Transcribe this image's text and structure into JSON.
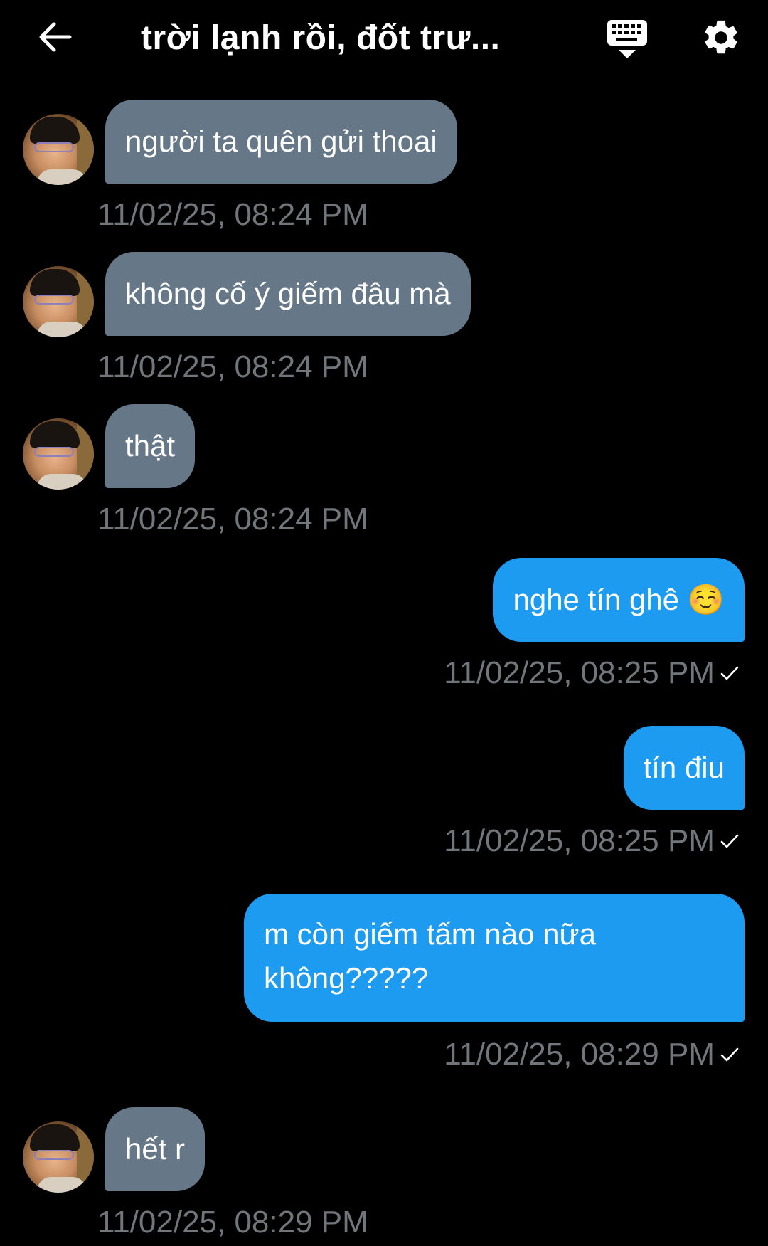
{
  "header": {
    "title": "trời lạnh rồi, đốt trư...",
    "back_icon": "arrow-left-icon",
    "keyboard_icon": "keyboard-icon",
    "settings_icon": "gear-icon"
  },
  "colors": {
    "background": "#000000",
    "incoming_bubble": "#667788",
    "outgoing_bubble": "#1d9bf0",
    "timestamp": "#71767b",
    "text": "#ffffff"
  },
  "messages": [
    {
      "direction": "in",
      "text": "người ta quên gửi thoai",
      "time": "11/02/25, 08:24 PM"
    },
    {
      "direction": "in",
      "text": "không cố ý giếm đâu mà",
      "time": "11/02/25, 08:24 PM"
    },
    {
      "direction": "in",
      "text": "thật",
      "time": "11/02/25, 08:24 PM"
    },
    {
      "direction": "out",
      "text": "nghe tín ghê ☺️",
      "time": "11/02/25, 08:25 PM",
      "status": "sent-check-icon"
    },
    {
      "direction": "out",
      "text": "tín điu",
      "time": "11/02/25, 08:25 PM",
      "status": "sent-check-icon"
    },
    {
      "direction": "out",
      "text": "m còn giếm tấm nào nữa không?????",
      "time": "11/02/25, 08:29 PM",
      "status": "sent-check-icon"
    },
    {
      "direction": "in",
      "text": "hết r",
      "time": "11/02/25, 08:29 PM"
    }
  ]
}
